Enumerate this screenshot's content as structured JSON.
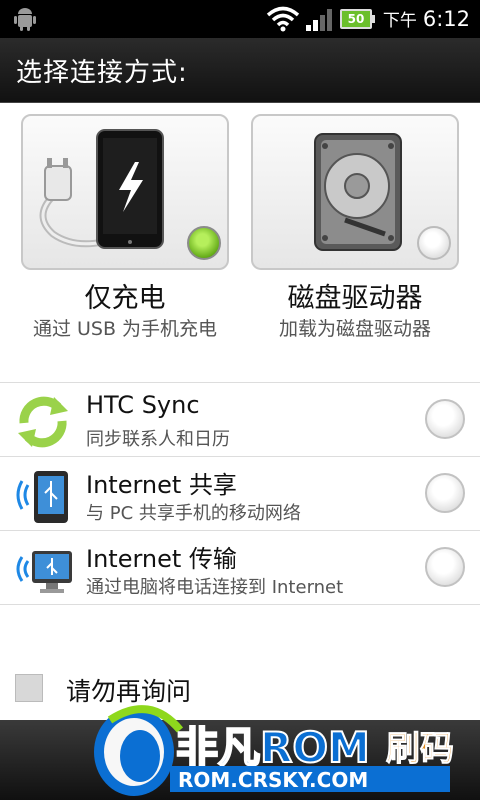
{
  "status_bar": {
    "battery_level": "50",
    "ampm": "下午",
    "time": "6:12"
  },
  "title": "选择连接方式:",
  "modes": [
    {
      "title": "仅充电",
      "subtitle": "通过 USB 为手机充电",
      "selected": true,
      "icon": "charger-phone-icon"
    },
    {
      "title": "磁盘驱动器",
      "subtitle": "加载为磁盘驱动器",
      "selected": false,
      "icon": "hard-disk-icon"
    }
  ],
  "options": [
    {
      "title": "HTC Sync",
      "subtitle": "同步联系人和日历",
      "icon": "sync-icon"
    },
    {
      "title": "Internet 共享",
      "subtitle": "与 PC 共享手机的移动网络",
      "icon": "phone-tethering-icon"
    },
    {
      "title": "Internet 传输",
      "subtitle": "通过电脑将电话连接到 Internet",
      "icon": "pc-internet-icon"
    }
  ],
  "dont_ask_label": "请勿再询问",
  "watermark": {
    "brand": "非凡ROM",
    "suffix": "刷码",
    "url": "ROM.CRSKY.COM"
  },
  "colors": {
    "selected_green": "#5ea613",
    "title_bar": "#1a1a1a",
    "watermark_blue": "#0b6fd3",
    "watermark_green": "#8ed81c"
  }
}
